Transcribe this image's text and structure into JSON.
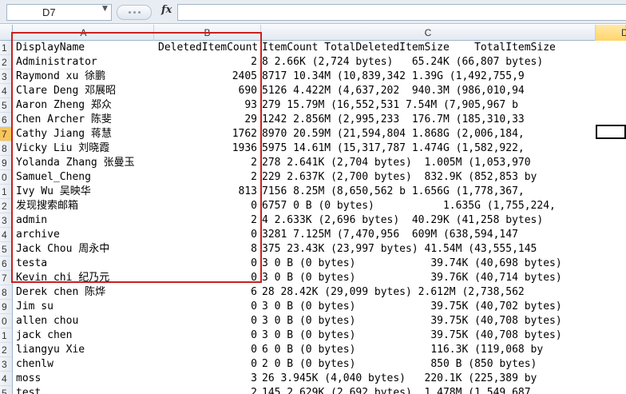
{
  "name_box": "D7",
  "fx_label": "fx",
  "column_headers": [
    "A",
    "B",
    "C",
    "D"
  ],
  "active_row": "7",
  "row_numbers": [
    "1",
    "2",
    "3",
    "4",
    "5",
    "6",
    "7",
    "8",
    "9",
    "0",
    "1",
    "2",
    "3",
    "4",
    "5",
    "6",
    "7",
    "8",
    "9",
    "0",
    "1",
    "2",
    "3",
    "4",
    "5"
  ],
  "header_row": {
    "a": "DisplayName",
    "b": "DeletedItemCount",
    "c": "ItemCount TotalDeletedItemSize    TotalItemSize"
  },
  "rows": [
    {
      "a": "Administrator",
      "b": "2",
      "c": "8 2.66K (2,724 bytes)   65.24K (66,807 bytes)"
    },
    {
      "a": "Raymond xu 徐鹏",
      "b": "2405",
      "c": "8717 10.34M (10,839,342 1.39G (1,492,755,9"
    },
    {
      "a": "Clare Deng 邓展昭",
      "b": "690",
      "c": "5126 4.422M (4,637,202  940.3M (986,010,94"
    },
    {
      "a": "Aaron Zheng 郑众",
      "b": "93",
      "c": "279 15.79M (16,552,531 7.54M (7,905,967 b"
    },
    {
      "a": "Chen Archer 陈斐",
      "b": "29",
      "c": "1242 2.856M (2,995,233  176.7M (185,310,33"
    },
    {
      "a": "Cathy Jiang 蒋慧",
      "b": "1762",
      "c": "8970 20.59M (21,594,804 1.868G (2,006,184,"
    },
    {
      "a": "Vicky Liu 刘晓霞",
      "b": "1936",
      "c": "5975 14.61M (15,317,787 1.474G (1,582,922,"
    },
    {
      "a": "Yolanda Zhang 张曼玉",
      "b": "2",
      "c": "278 2.641K (2,704 bytes)  1.005M (1,053,970"
    },
    {
      "a": "Samuel_Cheng",
      "b": "2",
      "c": "229 2.637K (2,700 bytes)  832.9K (852,853 by"
    },
    {
      "a": "Ivy Wu 吴映华",
      "b": "813",
      "c": "7156 8.25M (8,650,562 b 1.656G (1,778,367,"
    },
    {
      "a": "发现搜索邮箱",
      "b": "0",
      "c": "6757 0 B (0 bytes)           1.635G (1,755,224,"
    },
    {
      "a": "admin",
      "b": "2",
      "c": "4 2.633K (2,696 bytes)  40.29K (41,258 bytes)"
    },
    {
      "a": "archive",
      "b": "0",
      "c": "3281 7.125M (7,470,956  609M (638,594,147"
    },
    {
      "a": "Jack Chou 周永中",
      "b": "8",
      "c": "375 23.43K (23,997 bytes) 41.54M (43,555,145"
    },
    {
      "a": "testa",
      "b": "0",
      "c": "3 0 B (0 bytes)            39.74K (40,698 bytes)"
    },
    {
      "a": "Kevin chi 纪乃元",
      "b": "0",
      "c": "3 0 B (0 bytes)            39.76K (40,714 bytes)"
    },
    {
      "a": "Derek chen 陈烨",
      "b": "6",
      "c": "28 28.42K (29,099 bytes) 2.612M (2,738,562"
    },
    {
      "a": "Jim su",
      "b": "0",
      "c": "3 0 B (0 bytes)            39.75K (40,702 bytes)"
    },
    {
      "a": "allen chou",
      "b": "0",
      "c": "3 0 B (0 bytes)            39.75K (40,708 bytes)"
    },
    {
      "a": "jack chen",
      "b": "0",
      "c": "3 0 B (0 bytes)            39.75K (40,708 bytes)"
    },
    {
      "a": "liangyu Xie",
      "b": "0",
      "c": "6 0 B (0 bytes)            116.3K (119,068 by"
    },
    {
      "a": "chenlw",
      "b": "0",
      "c": "2 0 B (0 bytes)            850 B (850 bytes)"
    },
    {
      "a": "moss",
      "b": "3",
      "c": "26 3.945K (4,040 bytes)   220.1K (225,389 by"
    },
    {
      "a": "test",
      "b": "2",
      "c": "145 2.629K (2,692 bytes)  1.478M (1,549,687"
    }
  ]
}
